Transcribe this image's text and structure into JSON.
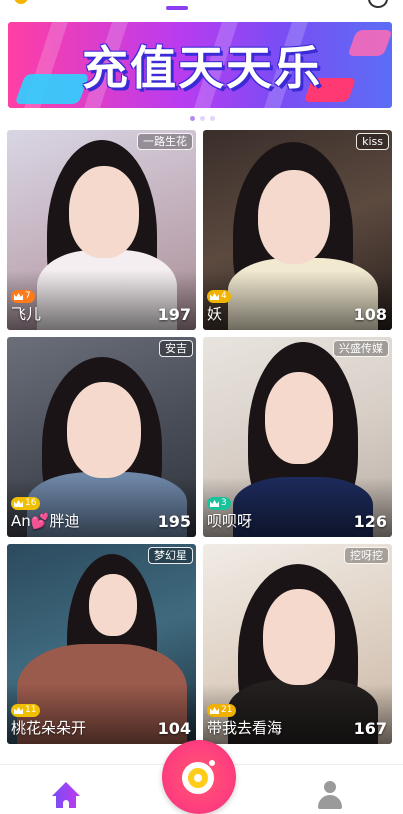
{
  "banner": {
    "text": "充值天天乐"
  },
  "cards": [
    {
      "name": "飞儿",
      "count": "197",
      "tag": "一路生花",
      "level": "7",
      "level_color": "#ff7a1a",
      "bg": "linear-gradient(160deg,#d9d6e4 0%,#c9b9c6 40%,#a98d95 100%)",
      "outfit": "#f4eef0"
    },
    {
      "name": "妖",
      "count": "108",
      "tag": "kiss",
      "level": "4",
      "level_color": "#f0b400",
      "bg": "linear-gradient(160deg,#3a2e2a 0%,#5c4a3f 50%,#2a201d 100%)",
      "outfit": "#f2ead0"
    },
    {
      "name": "An💕胖迪",
      "count": "195",
      "tag": "安吉",
      "level": "16",
      "level_color": "#f0c000",
      "bg": "linear-gradient(160deg,#6b6f7a 0%,#4a4f5a 50%,#2f333b 100%)",
      "outfit": "#6d86a6"
    },
    {
      "name": "呗呗呀",
      "count": "126",
      "tag": "兴盛传媒",
      "level": "3",
      "level_color": "#19c29a",
      "bg": "linear-gradient(160deg,#e9e4df 0%,#d8cfc7 50%,#b9aea5 100%)",
      "outfit": "#1d2b5c"
    },
    {
      "name": "桃花朵朵开",
      "count": "104",
      "tag": "梦幻星",
      "level": "11",
      "level_color": "#f0c000",
      "bg": "linear-gradient(160deg,#2c4a5e 0%,#3f6a7e 50%,#1f3442 100%)",
      "outfit": "#9a5a4c"
    },
    {
      "name": "带我去看海",
      "count": "167",
      "tag": "挖呀挖",
      "level": "21",
      "level_color": "#f0b000",
      "bg": "linear-gradient(160deg,#f1ece6 0%,#e0d3c6 50%,#c8b6a6 100%)",
      "outfit": "#252020"
    }
  ],
  "nav": {
    "home_icon": "home-icon",
    "camera_icon": "camera-icon",
    "profile_icon": "profile-icon"
  },
  "colors": {
    "accent": "#8c3df0",
    "camera": "#ff4a72"
  }
}
